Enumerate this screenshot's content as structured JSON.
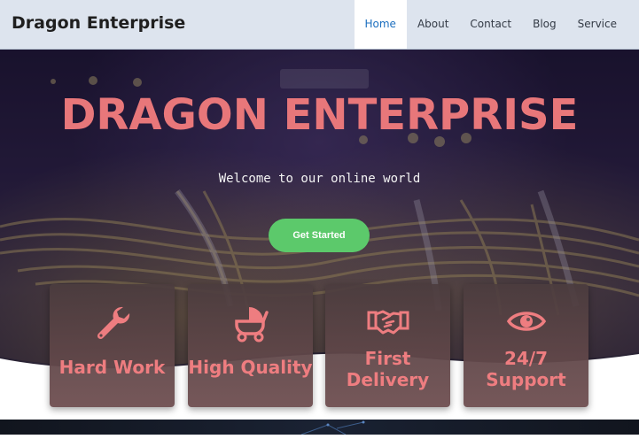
{
  "navbar": {
    "brand": "Dragon Enterprise",
    "links": [
      {
        "label": "Home",
        "active": true
      },
      {
        "label": "About",
        "active": false
      },
      {
        "label": "Contact",
        "active": false
      },
      {
        "label": "Blog",
        "active": false
      },
      {
        "label": "Service",
        "active": false
      }
    ]
  },
  "hero": {
    "title": "DRAGON ENTERPRISE",
    "subtitle": "Welcome to our online world",
    "cta_label": "Get Started"
  },
  "features": [
    {
      "icon": "wrench-icon",
      "label_line1": "Hard Work",
      "label_line2": ""
    },
    {
      "icon": "baby-carriage-icon",
      "label_line1": "High Quality",
      "label_line2": ""
    },
    {
      "icon": "handshake-icon",
      "label_line1": "First",
      "label_line2": "Delivery"
    },
    {
      "icon": "eye-icon",
      "label_line1": "24/7",
      "label_line2": "Support"
    }
  ],
  "colors": {
    "accent": "#e8777a",
    "cta": "#5cc96b",
    "nav_active": "#1c6fbf"
  }
}
